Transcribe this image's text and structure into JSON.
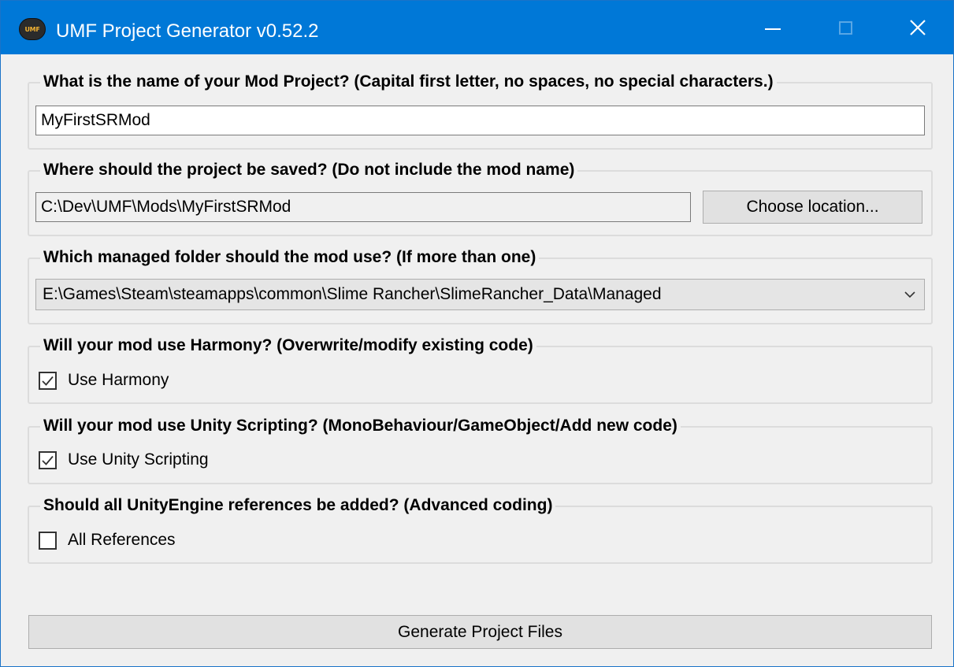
{
  "window": {
    "title": "UMF Project Generator v0.52.2",
    "app_icon_text": "UMF",
    "icons": {
      "minimize": "minimize-icon",
      "maximize": "maximize-icon",
      "close": "close-icon",
      "dropdown": "chevron-down-icon",
      "check": "checkmark-icon"
    },
    "accent_color": "#0078d7"
  },
  "project_name": {
    "label": "What is the name of your Mod Project? (Capital first letter, no spaces, no special characters.)",
    "value": "MyFirstSRMod"
  },
  "save_location": {
    "label": "Where should the project be saved? (Do not include the mod name)",
    "value": "C:\\Dev\\UMF\\Mods\\MyFirstSRMod",
    "button_label": "Choose location..."
  },
  "managed_folder": {
    "label": "Which managed folder should the mod use? (If more than one)",
    "selected": "E:\\Games\\Steam\\steamapps\\common\\Slime Rancher\\SlimeRancher_Data\\Managed"
  },
  "harmony": {
    "label": "Will your mod use Harmony? (Overwrite/modify existing code)",
    "checkbox_label": "Use Harmony",
    "checked": true
  },
  "unity_scripting": {
    "label": "Will your mod use Unity Scripting? (MonoBehaviour/GameObject/Add new code)",
    "checkbox_label": "Use Unity Scripting",
    "checked": true
  },
  "unity_references": {
    "label": "Should all UnityEngine references be added? (Advanced coding)",
    "checkbox_label": "All References",
    "checked": false
  },
  "generate_button_label": "Generate Project Files"
}
